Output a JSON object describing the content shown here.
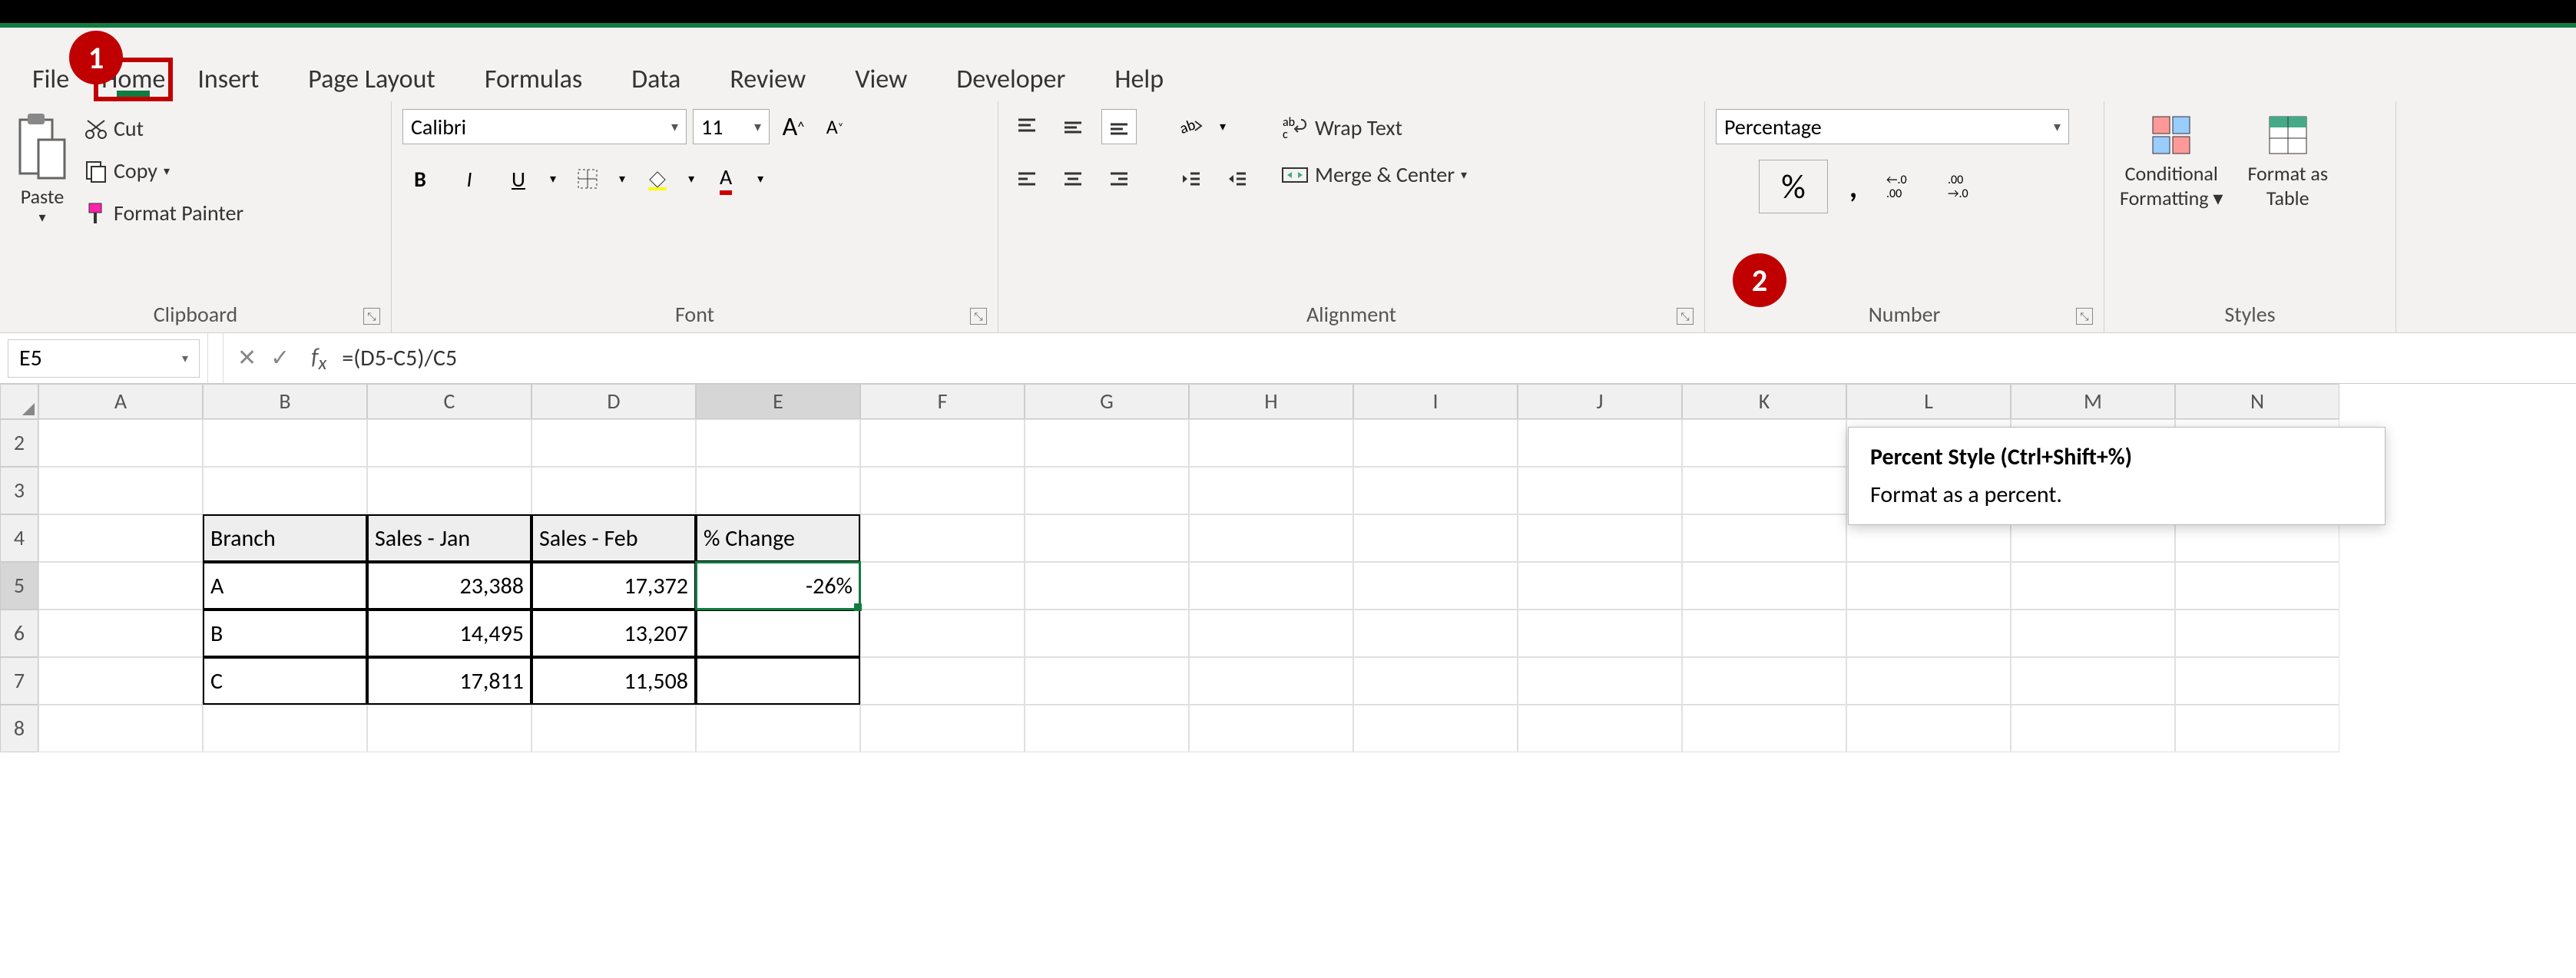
{
  "callouts": {
    "one": "1",
    "two": "2"
  },
  "tabs": [
    "File",
    "Home",
    "Insert",
    "Page Layout",
    "Formulas",
    "Data",
    "Review",
    "View",
    "Developer",
    "Help"
  ],
  "active_tab": "Home",
  "clipboard": {
    "paste": "Paste",
    "cut": "Cut",
    "copy": "Copy",
    "format_painter": "Format Painter",
    "label": "Clipboard"
  },
  "font": {
    "name": "Calibri",
    "size": "11",
    "bold": "B",
    "italic": "I",
    "underline": "U",
    "label": "Font"
  },
  "alignment": {
    "wrap": "Wrap Text",
    "merge": "Merge & Center",
    "label": "Alignment"
  },
  "number": {
    "format": "Percentage",
    "percent": "%",
    "comma": ",",
    "inc": ".00→.0",
    "dec": "←.0 .00",
    "label": "Number"
  },
  "styles": {
    "cond": "Conditional",
    "cond2": "Formatting",
    "table": "Format as",
    "table2": "Table",
    "label": "Styles"
  },
  "tooltip": {
    "title": "Percent Style (Ctrl+Shift+%)",
    "body": "Format as a percent."
  },
  "name_box": "E5",
  "formula": "=(D5-C5)/C5",
  "columns": [
    "A",
    "B",
    "C",
    "D",
    "E",
    "F",
    "G",
    "H",
    "I",
    "J",
    "K",
    "L",
    "M",
    "N"
  ],
  "selected_col": "E",
  "rows": [
    "2",
    "3",
    "4",
    "5",
    "6",
    "7",
    "8"
  ],
  "selected_row": "5",
  "table": {
    "headers": [
      "Branch",
      "Sales - Jan",
      "Sales - Feb",
      "% Change"
    ],
    "data": [
      {
        "branch": "A",
        "jan": "23,388",
        "feb": "17,372",
        "chg": "-26%"
      },
      {
        "branch": "B",
        "jan": "14,495",
        "feb": "13,207",
        "chg": ""
      },
      {
        "branch": "C",
        "jan": "17,811",
        "feb": "11,508",
        "chg": ""
      }
    ]
  }
}
